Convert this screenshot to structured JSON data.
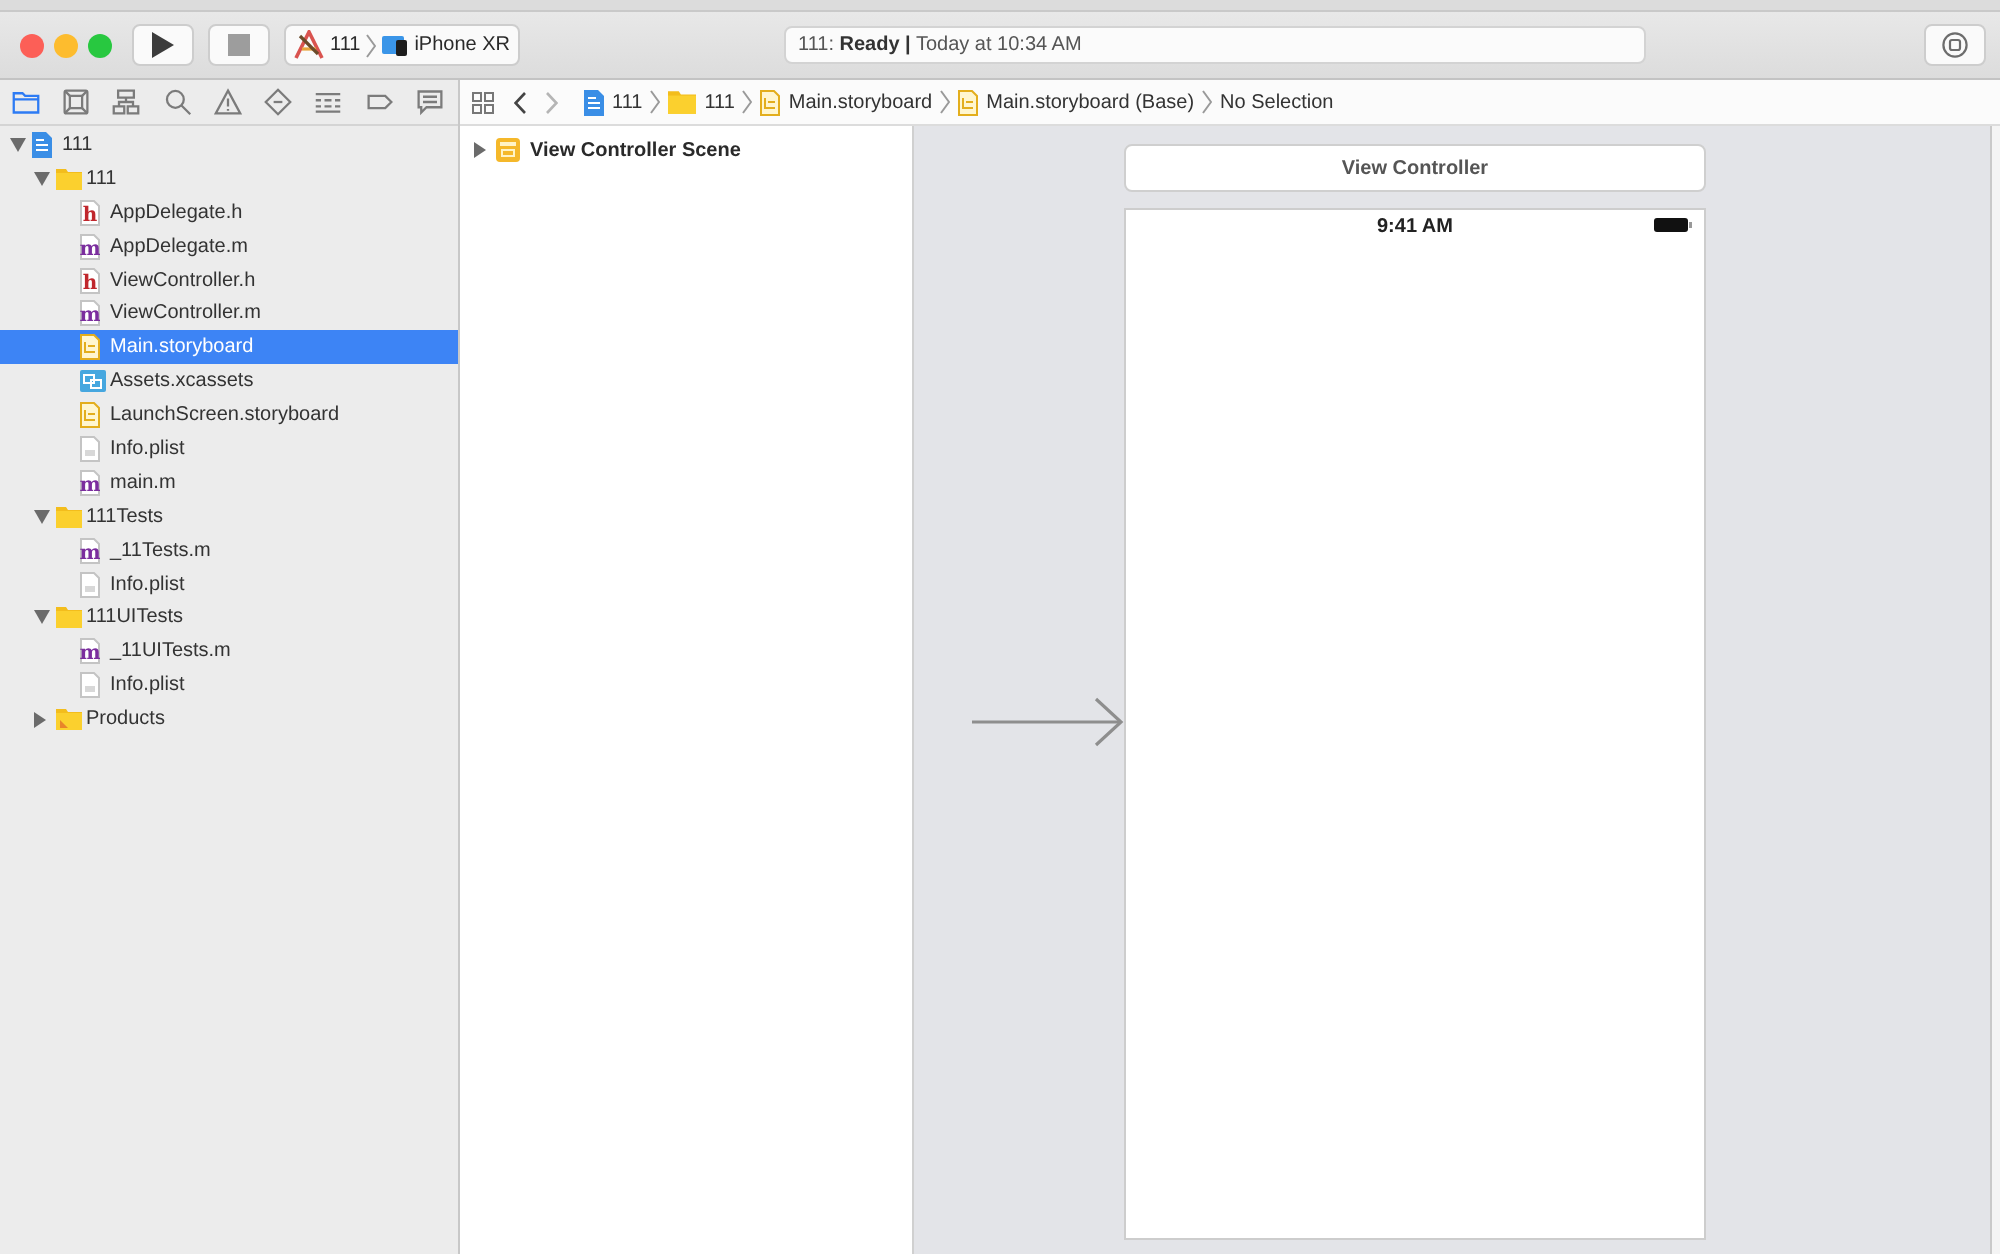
{
  "toolbar": {
    "buttons": [
      {
        "kind": "run",
        "disabled": false
      },
      {
        "kind": "stop",
        "disabled": true
      }
    ],
    "scheme": {
      "target": "111",
      "device": "iPhone XR"
    },
    "activity": "111: **Ready |** Today at 10:34 AM"
  },
  "navigator": {
    "tabs": [
      {
        "kind": "files",
        "selected": true
      },
      {
        "kind": "source_control",
        "selected": false
      },
      {
        "kind": "symbols",
        "selected": false
      },
      {
        "kind": "find",
        "selected": false
      },
      {
        "kind": "issues",
        "selected": false
      },
      {
        "kind": "tests",
        "selected": false
      },
      {
        "kind": "debug",
        "selected": false
      },
      {
        "kind": "breakpoints",
        "selected": false
      },
      {
        "kind": "reports",
        "selected": false
      }
    ],
    "tree": [
      {
        "label": "111",
        "kind": "project",
        "expanded": true,
        "selected": false,
        "children": [
          {
            "label": "111",
            "kind": "group",
            "expanded": true,
            "selected": false,
            "children": [
              {
                "label": "AppDelegate.h",
                "kind": "header",
                "badge": "h",
                "selected": false
              },
              {
                "label": "AppDelegate.m",
                "kind": "source",
                "badge": "m",
                "selected": false
              },
              {
                "label": "ViewController.h",
                "kind": "header",
                "badge": "h",
                "selected": false
              },
              {
                "label": "ViewController.m",
                "kind": "source",
                "badge": "m",
                "selected": false
              },
              {
                "label": "Main.storyboard",
                "kind": "storyboard",
                "selected": true
              },
              {
                "label": "Assets.xcassets",
                "kind": "assets",
                "selected": false
              },
              {
                "label": "LaunchScreen.storyboard",
                "kind": "storyboard",
                "selected": false
              },
              {
                "label": "Info.plist",
                "kind": "plist",
                "selected": false
              },
              {
                "label": "main.m",
                "kind": "source",
                "badge": "m",
                "selected": false
              }
            ]
          },
          {
            "label": "111Tests",
            "kind": "group",
            "expanded": true,
            "selected": false,
            "children": [
              {
                "label": "_11Tests.m",
                "kind": "source",
                "badge": "m",
                "selected": false
              },
              {
                "label": "Info.plist",
                "kind": "plist",
                "selected": false
              }
            ]
          },
          {
            "label": "111UITests",
            "kind": "group",
            "expanded": true,
            "selected": false,
            "children": [
              {
                "label": "_11UITests.m",
                "kind": "source",
                "badge": "m",
                "selected": false
              },
              {
                "label": "Info.plist",
                "kind": "plist",
                "selected": false
              }
            ]
          },
          {
            "label": "Products",
            "kind": "products",
            "expanded": false,
            "selected": false
          }
        ]
      }
    ]
  },
  "jump_bar": {
    "nav": [
      {
        "kind": "back",
        "disabled": false
      },
      {
        "kind": "forward",
        "disabled": true
      }
    ],
    "path": [
      {
        "label": "111",
        "kind": "project"
      },
      {
        "label": "111",
        "kind": "group"
      },
      {
        "label": "Main.storyboard",
        "kind": "storyboard"
      },
      {
        "label": "Main.storyboard (Base)",
        "kind": "storyboard"
      },
      {
        "label": "No Selection",
        "kind": "none"
      }
    ]
  },
  "outline": {
    "items": [
      {
        "label": "View Controller Scene",
        "expanded": false
      }
    ]
  },
  "canvas": {
    "scene_title": "View Controller",
    "status_time": "9:41 AM"
  }
}
